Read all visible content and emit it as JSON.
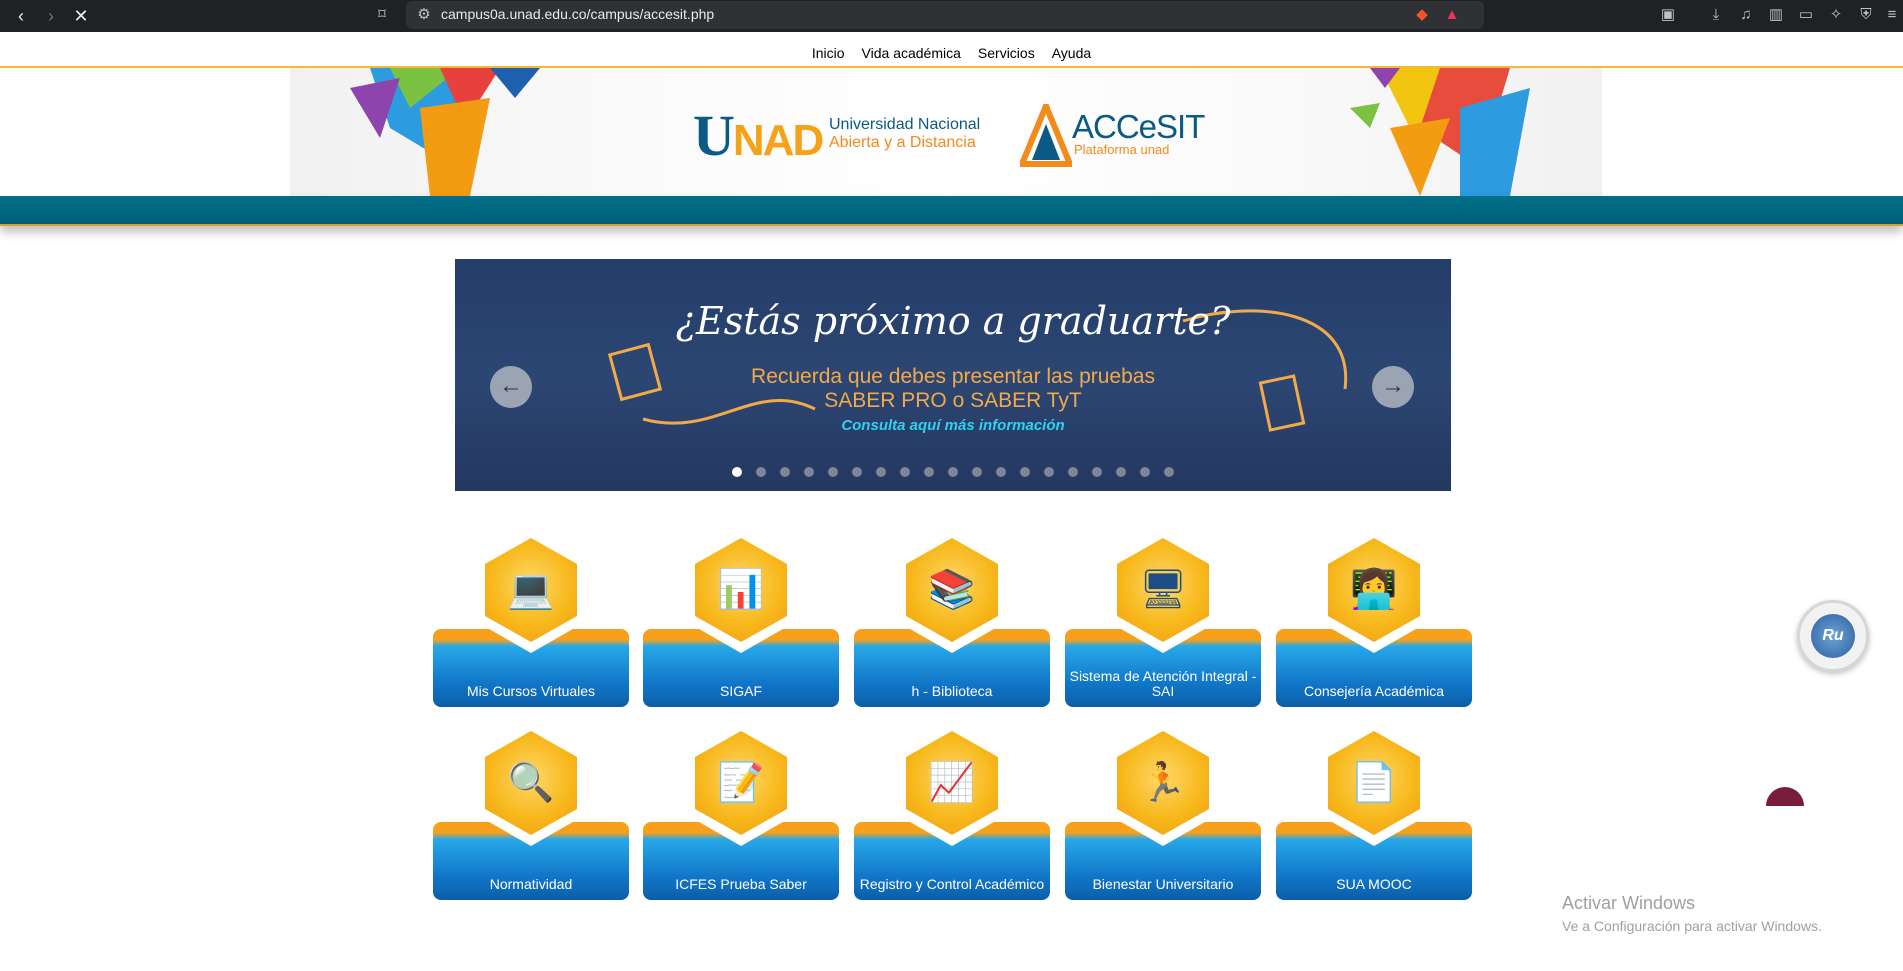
{
  "browser": {
    "url": "campus0a.unad.edu.co/campus/accesit.php"
  },
  "top_menu": {
    "items": [
      "Inicio",
      "Vida académica",
      "Servicios",
      "Ayuda"
    ]
  },
  "header": {
    "unad_u": "U",
    "unad_nad": "NAD",
    "unad_line1": "Universidad Nacional",
    "unad_line2": "Abierta y a Distancia",
    "accesit_name": "ACCeSIT",
    "accesit_sub": "Plataforma unad"
  },
  "carousel": {
    "title": "¿Estás próximo a graduarte?",
    "line1": "Recuerda que debes presentar las pruebas",
    "line2": "SABER PRO o SABER TyT",
    "link": "Consulta aquí más información",
    "dot_count": 19,
    "active_index": 0
  },
  "tiles": [
    {
      "label": "Mis Cursos Virtuales",
      "icon": "laptop-hand-icon"
    },
    {
      "label": "SIGAF",
      "icon": "chart-calculator-icon"
    },
    {
      "label": "h - Biblioteca",
      "icon": "books-icon"
    },
    {
      "label": "Sistema de Atención Integral - SAI",
      "icon": "support-agent-icon"
    },
    {
      "label": "Consejería Académica",
      "icon": "counselor-desk-icon"
    },
    {
      "label": "Normatividad",
      "icon": "magnifier-document-icon"
    },
    {
      "label": "ICFES Prueba Saber",
      "icon": "exam-sheet-icon"
    },
    {
      "label": "Registro y Control Académico",
      "icon": "laptop-chart-icon"
    },
    {
      "label": "Bienestar Universitario",
      "icon": "wellbeing-person-icon"
    },
    {
      "label": "SUA MOOC",
      "icon": "mooc-document-icon"
    }
  ],
  "assistant": {
    "label": "Ru"
  },
  "watermark": {
    "title": "Activar Windows",
    "subtitle": "Ve a Configuración para activar Windows."
  },
  "colors": {
    "teal": "#00708a",
    "accent_orange": "#f7a01b",
    "tile_blue": "#1176c8",
    "carousel_bg": "#2c4673"
  }
}
